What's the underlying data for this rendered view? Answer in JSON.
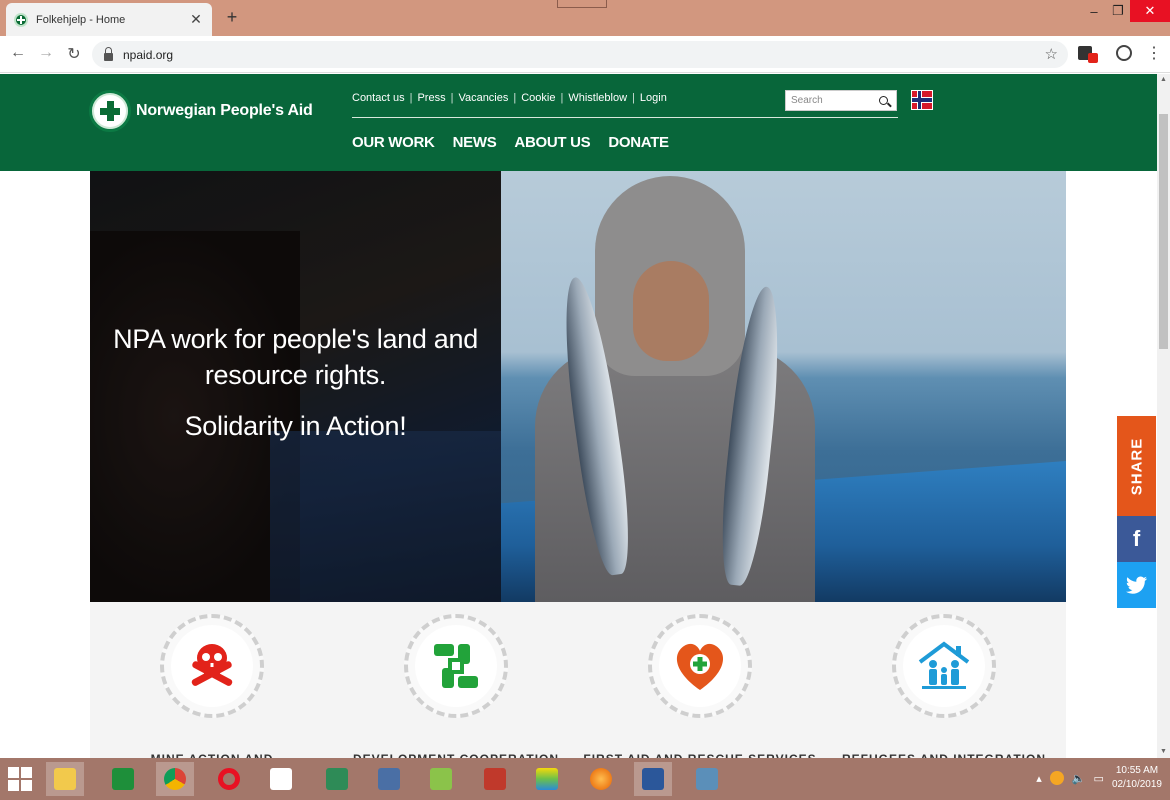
{
  "browser": {
    "tab_title": "Folkehjelp - Home",
    "tab_close": "✕",
    "new_tab": "+",
    "url": "npaid.org",
    "window_min": "–",
    "window_max": "❐",
    "window_close": "✕"
  },
  "site": {
    "brand": "Norwegian People's Aid",
    "util_links": [
      "Contact us",
      "Press",
      "Vacancies",
      "Cookie",
      "Whistleblow",
      "Login"
    ],
    "util_sep": "|",
    "nav": [
      "OUR WORK",
      "NEWS",
      "ABOUT US",
      "DONATE"
    ],
    "search_placeholder": "Search",
    "accent_color": "#08663a"
  },
  "hero": {
    "line1": "NPA work for people's land and",
    "line2": "resource rights.",
    "tagline": "Solidarity in Action!"
  },
  "programs": [
    {
      "label": "MINE ACTION AND",
      "icon": "skull-crossbones-icon",
      "color": "#e2231a"
    },
    {
      "label": "DEVELOPMENT COOPERATION",
      "icon": "hands-together-icon",
      "color": "#22a33a"
    },
    {
      "label": "FIRST AID AND RESCUE SERVICES",
      "icon": "heart-cross-icon",
      "color": "#e4561b"
    },
    {
      "label": "REFUGEES AND INTEGRATION",
      "icon": "family-house-icon",
      "color": "#1e9bd7"
    }
  ],
  "share": {
    "label": "SHARE",
    "facebook": "f"
  },
  "taskbar": {
    "time": "10:55 AM",
    "date": "02/10/2019"
  }
}
